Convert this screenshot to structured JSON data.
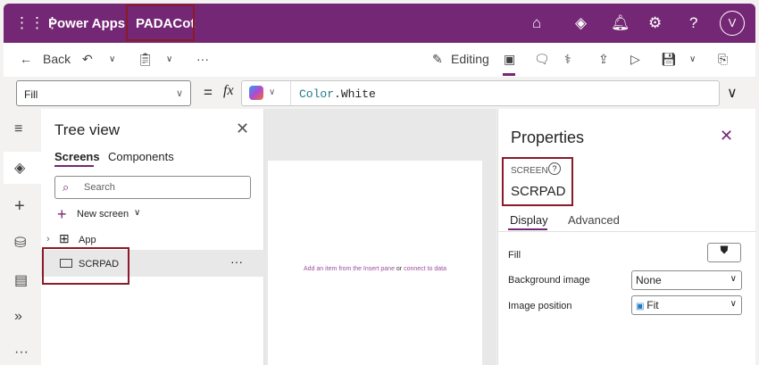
{
  "header": {
    "app_name": "Power Apps",
    "separator": "|",
    "app_title": "PADACot",
    "avatar": "V"
  },
  "toolbar": {
    "back": "Back",
    "more": "···",
    "editing": "Editing"
  },
  "formula": {
    "property": "Fill",
    "equals": "=",
    "fx": "fx",
    "value_obj": "Color",
    "value_prop": ".White"
  },
  "tree": {
    "title": "Tree view",
    "tabs": [
      "Screens",
      "Components"
    ],
    "search_placeholder": "Search",
    "new_screen": "New screen",
    "items": [
      "App",
      "SCRPAD"
    ],
    "more": "···"
  },
  "canvas": {
    "hint_link1": "Add an item from the Insert pane",
    "hint_or": " or ",
    "hint_link2": "connect to data"
  },
  "properties": {
    "title": "Properties",
    "type_label": "SCREEN",
    "screen_name": "SCRPAD",
    "tabs": [
      "Display",
      "Advanced"
    ],
    "rows": [
      {
        "label": "Fill"
      },
      {
        "label": "Background image",
        "value": "None"
      },
      {
        "label": "Image position",
        "value": "Fit"
      }
    ]
  },
  "colors": {
    "brand": "#742774",
    "highlight": "#8b1a2a"
  }
}
